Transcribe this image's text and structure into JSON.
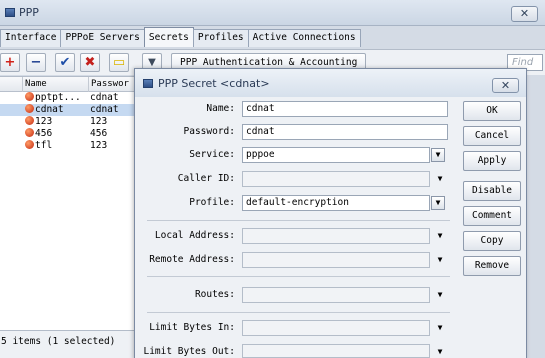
{
  "window": {
    "title": "PPP",
    "close_glyph": "✕"
  },
  "tabs": [
    {
      "label": "Interface"
    },
    {
      "label": "PPPoE Servers"
    },
    {
      "label": "Secrets",
      "active": true
    },
    {
      "label": "Profiles"
    },
    {
      "label": "Active Connections"
    }
  ],
  "toolbar": {
    "ppp_auth_label": "PPP Authentication & Accounting",
    "find_placeholder": "Find"
  },
  "list": {
    "columns": [
      "Name",
      "Passwor"
    ],
    "rows": [
      {
        "name": "pptpt...",
        "password": "cdnat",
        "selected": false
      },
      {
        "name": "cdnat",
        "password": "cdnat",
        "selected": true
      },
      {
        "name": "123",
        "password": "123",
        "selected": false
      },
      {
        "name": "456",
        "password": "456",
        "selected": false
      },
      {
        "name": "tfl",
        "password": "123",
        "selected": false
      }
    ]
  },
  "status": "5 items (1 selected)",
  "dialog": {
    "title": "PPP Secret <cdnat>",
    "close_glyph": "✕",
    "fields": {
      "name": {
        "label": "Name:",
        "value": "cdnat"
      },
      "password": {
        "label": "Password:",
        "value": "cdnat"
      },
      "service": {
        "label": "Service:",
        "value": "pppoe"
      },
      "caller_id": {
        "label": "Caller ID:",
        "value": ""
      },
      "profile": {
        "label": "Profile:",
        "value": "default-encryption"
      },
      "local_address": {
        "label": "Local Address:",
        "value": ""
      },
      "remote_address": {
        "label": "Remote Address:",
        "value": ""
      },
      "routes": {
        "label": "Routes:",
        "value": ""
      },
      "limit_bytes_in": {
        "label": "Limit Bytes In:",
        "value": ""
      },
      "limit_bytes_out": {
        "label": "Limit Bytes Out:",
        "value": ""
      }
    },
    "buttons": {
      "ok": "OK",
      "cancel": "Cancel",
      "apply": "Apply",
      "disable": "Disable",
      "comment": "Comment",
      "copy": "Copy",
      "remove": "Remove"
    }
  },
  "icons": {
    "add": "+",
    "remove": "−",
    "enable": "✔",
    "disable": "✖",
    "comment": "▭",
    "filter": "▼",
    "dropdown_toggle": "▼",
    "dropdown_arrow": "▼"
  },
  "colors": {
    "add": "#d0221a",
    "remove": "#1f3f8f",
    "enable": "#1f4fa8",
    "disable": "#c4201c",
    "comment": "#d9b400",
    "selection": "#c5d9f1"
  }
}
